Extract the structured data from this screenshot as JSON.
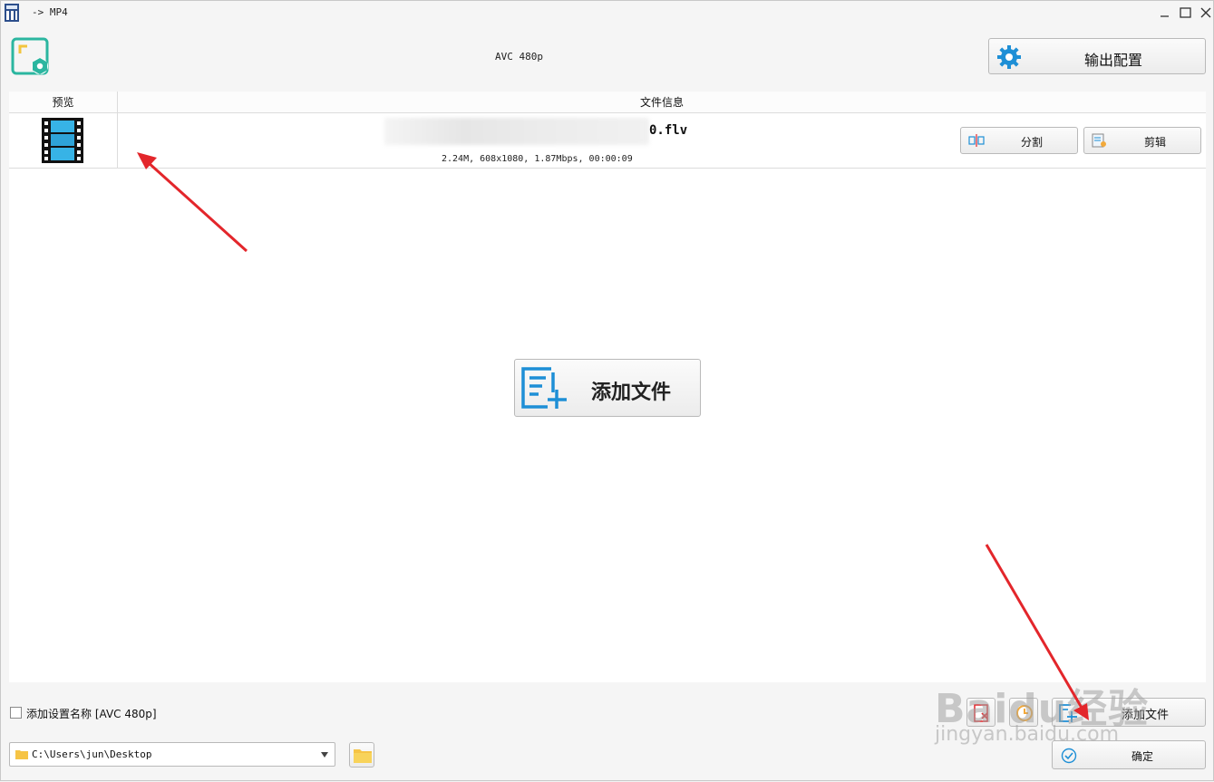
{
  "window": {
    "title": "-> MP4",
    "controls": [
      "minimize-icon",
      "maximize-icon",
      "close-icon"
    ]
  },
  "header": {
    "profile": "AVC 480p",
    "output_config_label": "输出配置"
  },
  "table": {
    "col_preview": "预览",
    "col_info": "文件信息",
    "rows": [
      {
        "file_name": "0.flv",
        "meta": "2.24M, 608x1080, 1.87Mbps, 00:00:09",
        "split_label": "分割",
        "trim_label": "剪辑"
      }
    ]
  },
  "center": {
    "add_files_label": "添加文件"
  },
  "footer": {
    "add_setting_name_label": "添加设置名称 [AVC 480p]",
    "add_setting_name_checked": false,
    "output_path": "C:\\Users\\jun\\Desktop",
    "add_files_label": "添加文件",
    "ok_label": "确定"
  },
  "watermark": {
    "main": "Baidu经验",
    "sub": "jingyan.baidu.com"
  },
  "colors": {
    "accent_blue": "#1e8fd6",
    "logo_green": "#2bb6a0",
    "logo_yellow": "#f2c53d",
    "arrow_red": "#e3262b"
  }
}
